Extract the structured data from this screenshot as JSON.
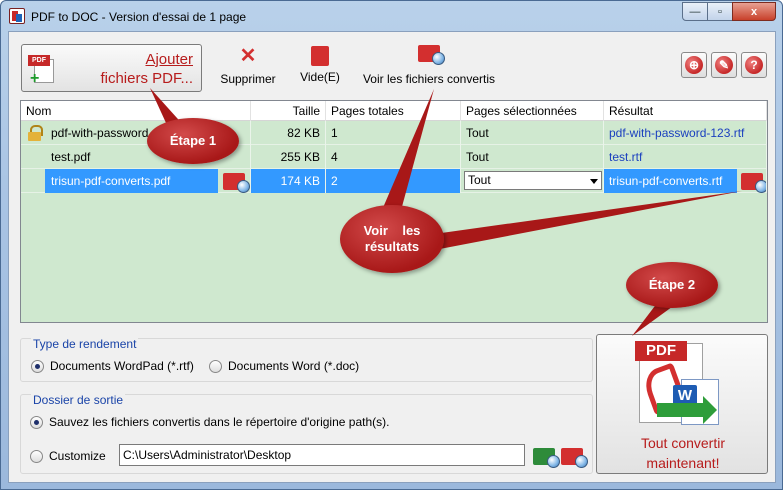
{
  "window": {
    "title": "PDF to DOC - Version d'essai de 1 page",
    "minimize": "—",
    "maximize": "▫",
    "close": "x"
  },
  "toolbar": {
    "add_line1": "Ajouter",
    "add_line2": "fichiers PDF...",
    "delete_label": "Supprimer",
    "empty_label": "Vide(E)",
    "view_label": "Voir les fichiers convertis",
    "delete_icon": "red-x-icon",
    "empty_icon": "trash-bin-icon",
    "view_icon": "folder-magnifier-icon"
  },
  "top_right_buttons": [
    {
      "name": "globe-icon",
      "glyph": "⊕"
    },
    {
      "name": "wrench-icon",
      "glyph": "✎"
    },
    {
      "name": "help-icon",
      "glyph": "?"
    }
  ],
  "grid": {
    "headers": [
      "Nom",
      "Taille",
      "Pages totales",
      "Pages sélectionnées",
      "Résultat"
    ],
    "rows": [
      {
        "name": "pdf-with-password.pdf",
        "size": "82 KB",
        "total_pages": "1",
        "selected_pages": "Tout",
        "result": "pdf-with-password-123.rtf",
        "locked": true
      },
      {
        "name": "test.pdf",
        "size": "255 KB",
        "total_pages": "4",
        "selected_pages": "Tout",
        "result": "test.rtf",
        "locked": false
      },
      {
        "name": "trisun-pdf-converts.pdf",
        "size": "174 KB",
        "total_pages": "2",
        "selected_pages": "Tout",
        "result": "trisun-pdf-converts.rtf",
        "locked": false
      }
    ]
  },
  "annotations": {
    "step1": "Étape 1",
    "step2": "Étape 2",
    "view_results_line1": "Voir    les",
    "view_results_line2": "résultats"
  },
  "render_type": {
    "title": "Type de rendement",
    "option_wordpad": "Documents WordPad (*.rtf)",
    "option_word": "Documents Word (*.doc)",
    "selected": "wordpad"
  },
  "output_folder": {
    "title": "Dossier de sortie",
    "option_origin": "Sauvez les fichiers convertis dans le répertoire d'origine path(s).",
    "option_customize": "Customize",
    "path": "C:\\Users\\Administrator\\Desktop",
    "selected": "origin"
  },
  "convert": {
    "line1": "Tout convertir",
    "line2": "maintenant!",
    "pdf_tag": "PDF",
    "word_tag": "W"
  },
  "colors": {
    "accent_red": "#b71c1c",
    "grid_green": "#cfe8cf",
    "selection_blue": "#3399ff",
    "link_blue": "#1a3fbf",
    "group_title_blue": "#1a44a8"
  }
}
